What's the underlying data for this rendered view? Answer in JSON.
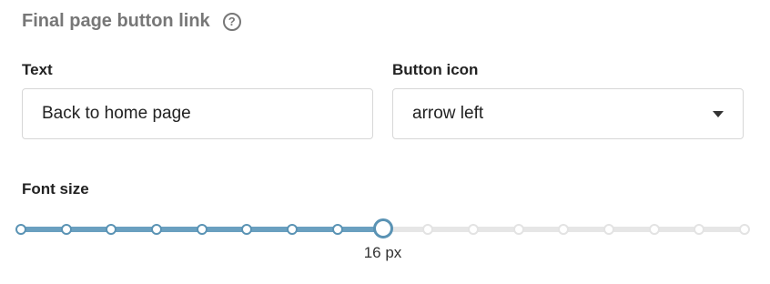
{
  "section": {
    "title": "Final page button link",
    "help_icon": "question-circle-icon",
    "help_glyph": "?"
  },
  "text_field": {
    "label": "Text",
    "value": "Back to home page"
  },
  "icon_field": {
    "label": "Button icon",
    "selected": "arrow left",
    "caret_icon": "caret-down-icon"
  },
  "font_size": {
    "label": "Font size",
    "value": 16,
    "unit": "px",
    "display": "16 px",
    "steps_total": 17,
    "selected_step_index": 8
  },
  "colors": {
    "accent": "#5a93b4",
    "track_inactive": "#e6e6e6",
    "title_gray": "#777777"
  }
}
